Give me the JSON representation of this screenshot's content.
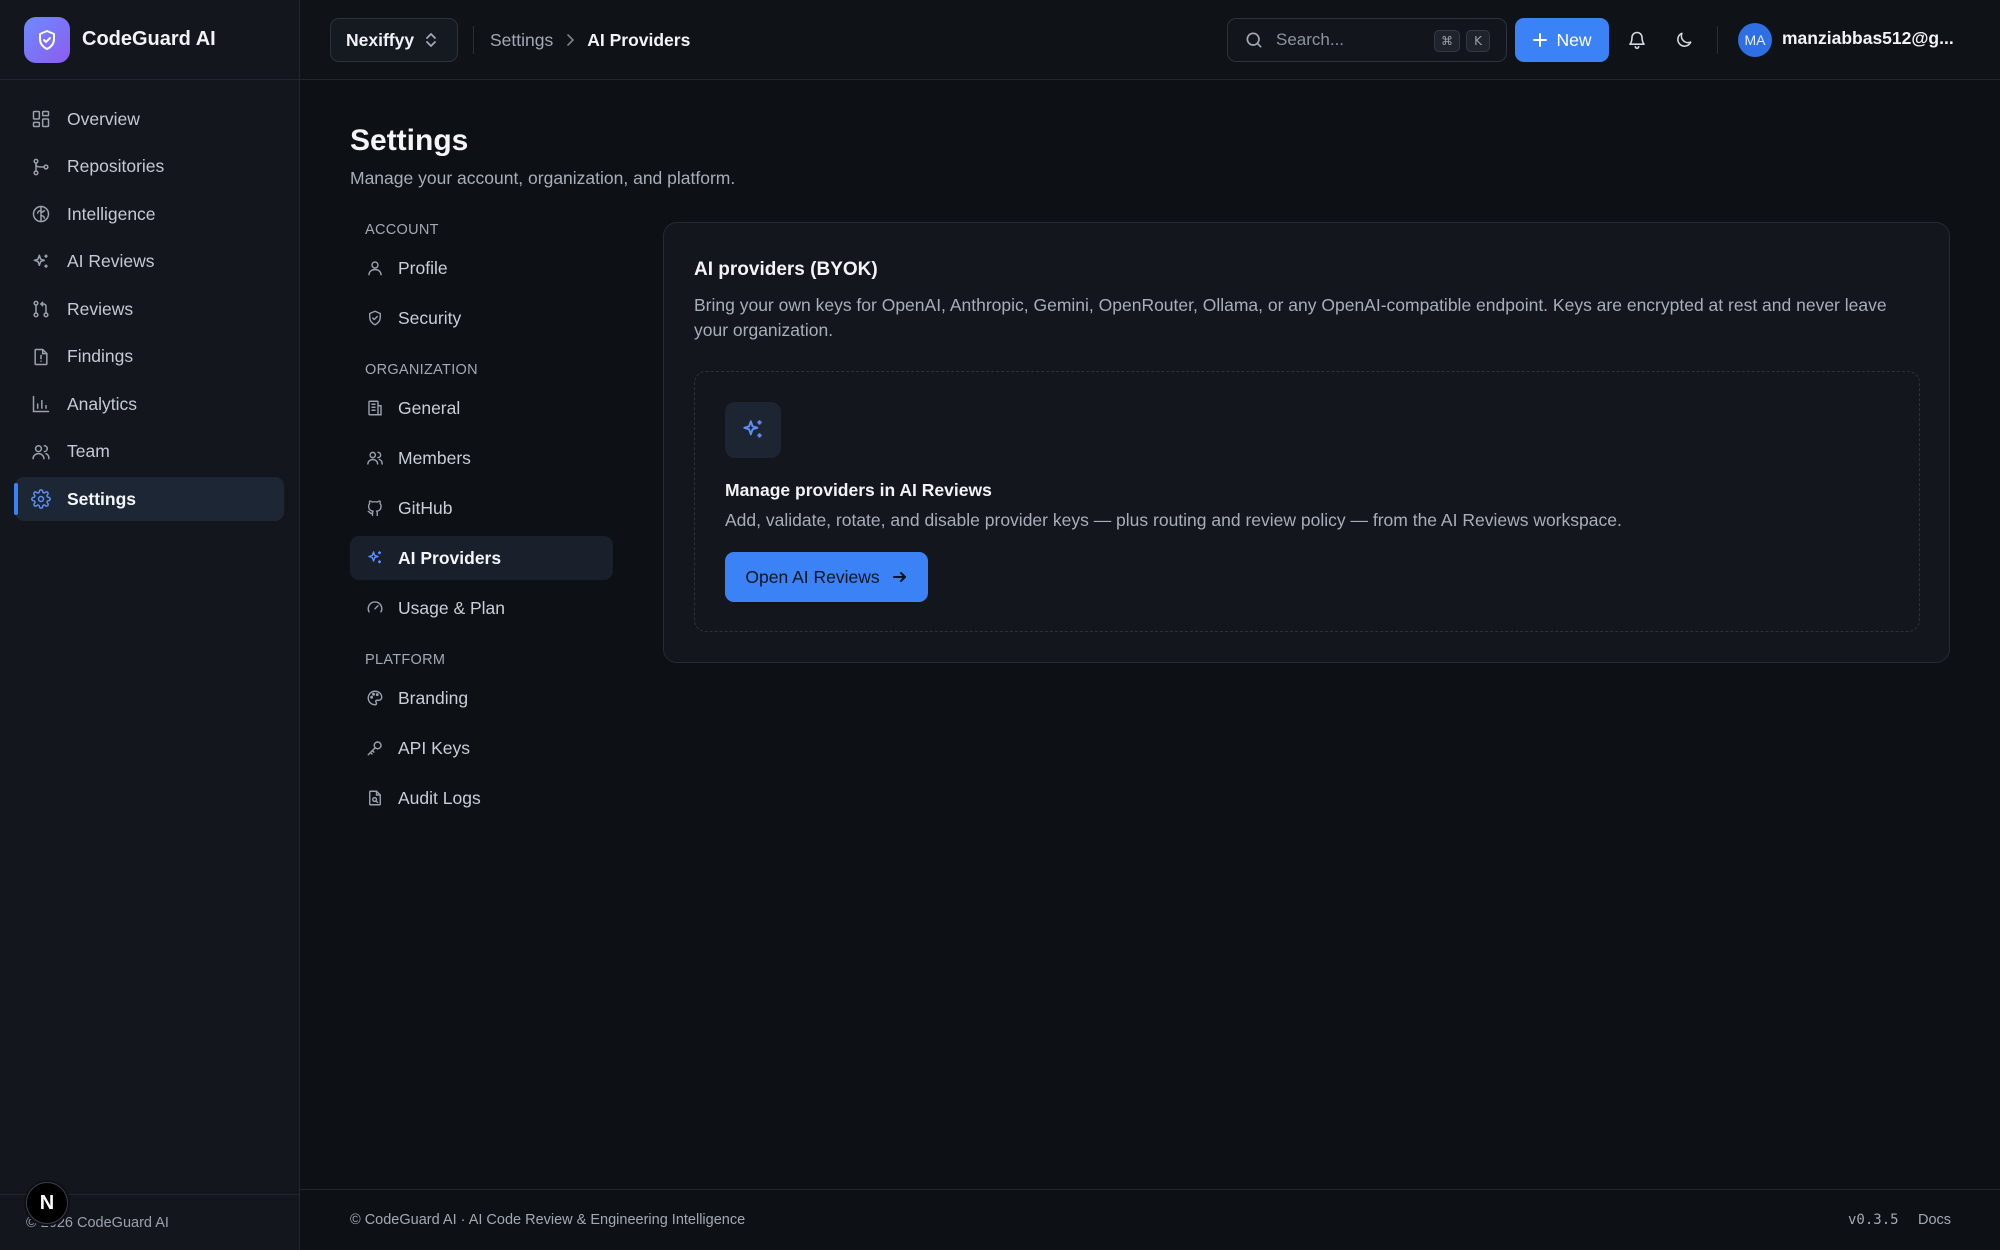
{
  "app": {
    "name": "CodeGuard AI",
    "footer_copyright": "© 2026 CodeGuard AI"
  },
  "sidebar": {
    "items": [
      {
        "label": "Overview",
        "icon": "grid-icon"
      },
      {
        "label": "Repositories",
        "icon": "git-branch-icon"
      },
      {
        "label": "Intelligence",
        "icon": "brain-icon"
      },
      {
        "label": "AI Reviews",
        "icon": "sparkles-icon"
      },
      {
        "label": "Reviews",
        "icon": "git-pull-request-icon"
      },
      {
        "label": "Findings",
        "icon": "file-alert-icon"
      },
      {
        "label": "Analytics",
        "icon": "bar-chart-icon"
      },
      {
        "label": "Team",
        "icon": "users-icon"
      },
      {
        "label": "Settings",
        "icon": "gear-icon",
        "active": true
      }
    ]
  },
  "topbar": {
    "org": "Nexiffyy",
    "breadcrumb": [
      "Settings",
      "AI Providers"
    ],
    "search_placeholder": "Search...",
    "shortcut_keys": [
      "⌘",
      "K"
    ],
    "new_label": "New",
    "avatar_initials": "MA",
    "user_email": "manziabbas512@g..."
  },
  "page": {
    "title": "Settings",
    "subtitle": "Manage your account, organization, and platform."
  },
  "settings_nav": {
    "account_heading": "ACCOUNT",
    "account": [
      {
        "label": "Profile",
        "icon": "user-icon"
      },
      {
        "label": "Security",
        "icon": "shield-check-icon"
      }
    ],
    "organization_heading": "ORGANIZATION",
    "organization": [
      {
        "label": "General",
        "icon": "building-icon"
      },
      {
        "label": "Members",
        "icon": "users-icon"
      },
      {
        "label": "GitHub",
        "icon": "github-icon"
      },
      {
        "label": "AI Providers",
        "icon": "sparkles-icon",
        "active": true
      },
      {
        "label": "Usage & Plan",
        "icon": "gauge-icon"
      }
    ],
    "platform_heading": "PLATFORM",
    "platform": [
      {
        "label": "Branding",
        "icon": "palette-icon"
      },
      {
        "label": "API Keys",
        "icon": "key-icon"
      },
      {
        "label": "Audit Logs",
        "icon": "file-search-icon"
      }
    ]
  },
  "card": {
    "title": "AI providers (BYOK)",
    "description": "Bring your own keys for OpenAI, Anthropic, Gemini, OpenRouter, Ollama, or any OpenAI-compatible endpoint. Keys are encrypted at rest and never leave your organization.",
    "inner_title": "Manage providers in AI Reviews",
    "inner_description": "Add, validate, rotate, and disable provider keys — plus routing and review policy — from the AI Reviews workspace.",
    "button_label": "Open AI Reviews"
  },
  "footer": {
    "left": "© CodeGuard AI · AI Code Review & Engineering Intelligence",
    "version": "v0.3.5",
    "docs": "Docs"
  },
  "colors": {
    "accent": "#3b82f6",
    "background": "#0d1015",
    "sidebar": "#13161c"
  }
}
